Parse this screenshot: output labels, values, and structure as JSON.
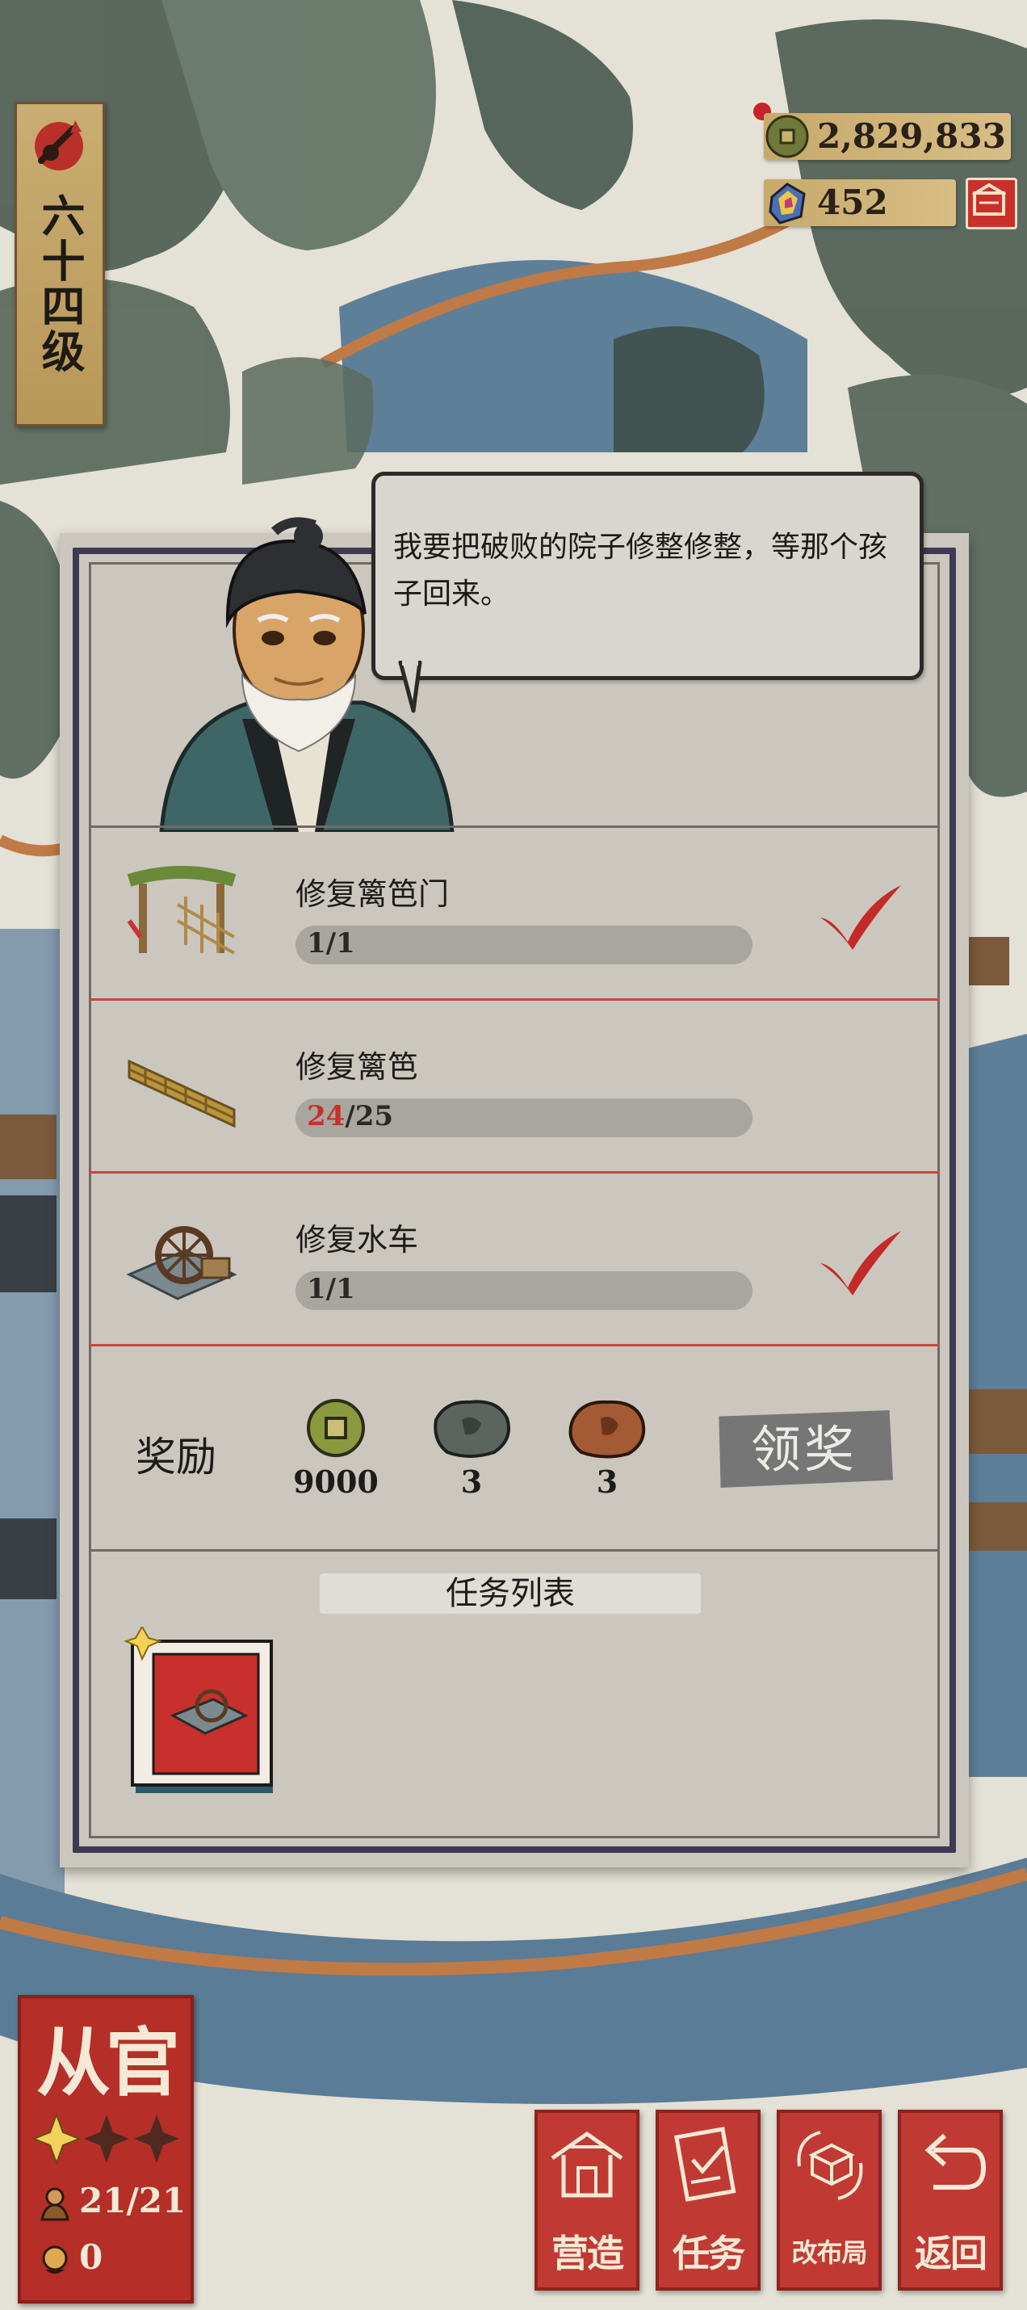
{
  "level": {
    "label": "六十四级"
  },
  "resources": {
    "coins": "2,829,833",
    "gems": "452"
  },
  "dialog": {
    "text": "我要把破败的院子修整修整，等那个孩子回来。"
  },
  "tasks": [
    {
      "title": "修复篱笆门",
      "current": "1",
      "total": "/1",
      "done": true,
      "icon": "gate-icon"
    },
    {
      "title": "修复篱笆",
      "current": "24",
      "total": "/25",
      "done": false,
      "icon": "fence-icon"
    },
    {
      "title": "修复水车",
      "current": "1",
      "total": "/1",
      "done": true,
      "icon": "waterwheel-icon"
    }
  ],
  "rewards": {
    "label": "奖励",
    "items": [
      {
        "icon": "coin-icon",
        "amount": "9000"
      },
      {
        "icon": "grey-ore-icon",
        "amount": "3"
      },
      {
        "icon": "copper-ore-icon",
        "amount": "3"
      }
    ],
    "claim_label": "领奖"
  },
  "task_list": {
    "header": "任务列表"
  },
  "rank": {
    "title": "从官",
    "stars_filled": 1,
    "stars_total": 3,
    "people": "21/21",
    "other": "0"
  },
  "actions": [
    {
      "label": "营造",
      "icon": "building-icon"
    },
    {
      "label": "任务",
      "icon": "scroll-icon"
    },
    {
      "label": "改布局",
      "icon": "layout-icon"
    },
    {
      "label": "返回",
      "icon": "return-icon"
    }
  ],
  "colors": {
    "accent_red": "#c03a33",
    "progress_red": "#c8302c",
    "panel_border": "#3d3a52"
  }
}
